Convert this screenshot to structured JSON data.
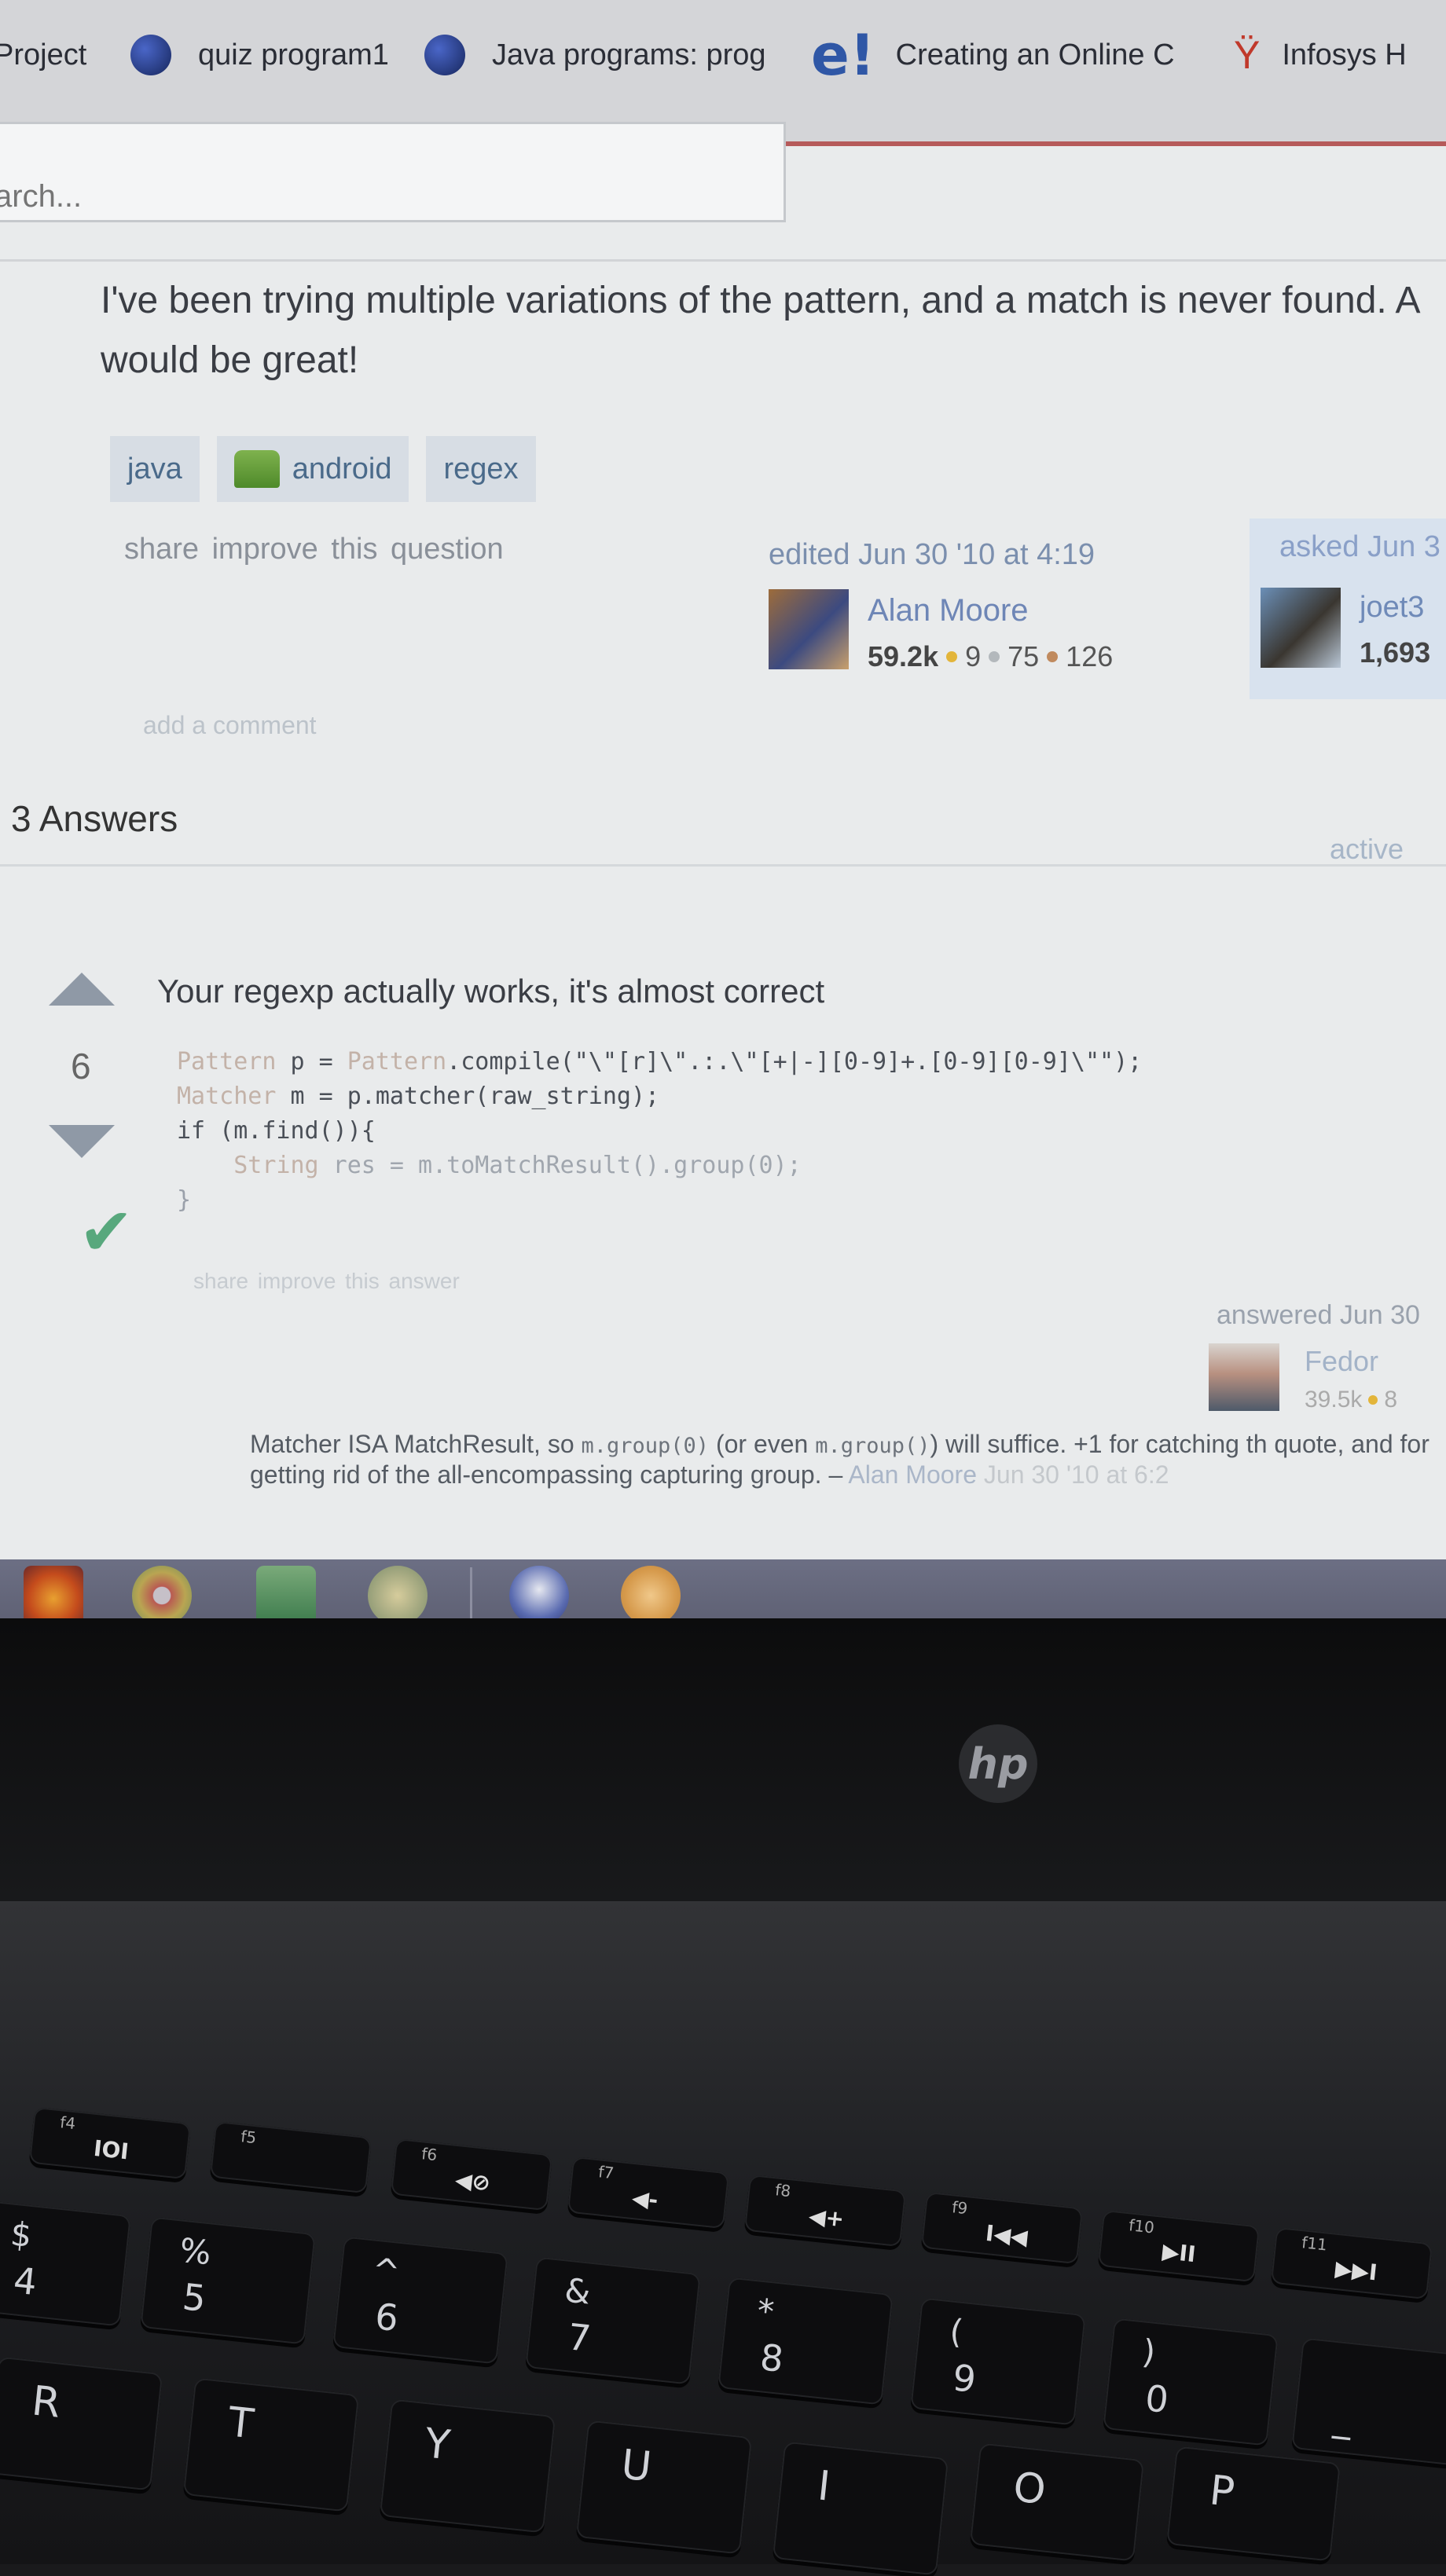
{
  "browser": {
    "bookmarks": [
      {
        "label": "Project",
        "icon": "none"
      },
      {
        "label": "quiz program1",
        "icon": "globe-icon"
      },
      {
        "label": "Java programs: prog",
        "icon": "globe-icon"
      },
      {
        "label": "Creating an Online C",
        "icon": "e-logo-icon"
      },
      {
        "label": "Infosys H",
        "icon": "infosys-icon"
      }
    ],
    "search_placeholder": "arch..."
  },
  "question": {
    "text": "I've been trying multiple variations of the pattern, and a match is never found. A would be great!",
    "tags": [
      "java",
      "android",
      "regex"
    ],
    "links": "share improve this question",
    "edited": {
      "label": "edited Jun 30 '10 at 4:19",
      "user": "Alan Moore",
      "rep": "59.2k",
      "gold": "9",
      "silver": "75",
      "bronze": "126"
    },
    "asked": {
      "label": "asked Jun 3",
      "user": "joet3",
      "rep": "1,693"
    },
    "add_comment": "add a comment"
  },
  "answers": {
    "heading": "3 Answers",
    "sort_tab": "active",
    "items": [
      {
        "votes": "6",
        "accepted": true,
        "intro": "Your regexp actually works, it's almost correct",
        "code": {
          "line1_type": "Pattern",
          "line1_rest": " p = ",
          "line1_call": "Pattern",
          "line1_tail": ".compile(\"\\\"[r]\\\".:.\\\"[+|-][0-9]+.[0-9][0-9]\\\"\");",
          "line2_type": "Matcher",
          "line2_rest": " m = p.matcher(raw_string);",
          "line3": "if (m.find()){",
          "line4_type": "String",
          "line4_rest": " res = m.toMatchResult().group(0);",
          "line5": "}"
        },
        "links": "share improve this answer",
        "answered": {
          "label": "answered Jun 30",
          "user": "Fedor",
          "rep": "39.5k",
          "gold": "8"
        },
        "comment": {
          "part1": "Matcher ISA MatchResult, so ",
          "code1": "m.group(0)",
          "part2": " (or even ",
          "code2": "m.group()",
          "part3": ") will suffice. +1 for catching th quote, and for getting rid of the all-encompassing capturing group. – ",
          "user": "Alan Moore",
          "date": " Jun 30 '10 at 6:2"
        }
      }
    ]
  },
  "taskbar": {
    "apps": [
      "firefox-icon",
      "chrome-icon",
      "store-icon",
      "app-icon",
      "globe-app-icon",
      "settings-app-icon"
    ]
  },
  "laptop": {
    "brand": "hp",
    "function_keys": [
      {
        "num": "f4",
        "sym": "IOI"
      },
      {
        "num": "f5",
        "sym": ""
      },
      {
        "num": "f6",
        "sym": "◀⊘"
      },
      {
        "num": "f7",
        "sym": "◀-"
      },
      {
        "num": "f8",
        "sym": "◀+"
      },
      {
        "num": "f9",
        "sym": "I◀◀"
      },
      {
        "num": "f10",
        "sym": "▶II"
      },
      {
        "num": "f11",
        "sym": "▶▶I"
      }
    ],
    "number_keys": [
      {
        "top": "$",
        "bottom": "4"
      },
      {
        "top": "%",
        "bottom": "5"
      },
      {
        "top": "^",
        "bottom": "6"
      },
      {
        "top": "&",
        "bottom": "7"
      },
      {
        "top": "*",
        "bottom": "8"
      },
      {
        "top": "(",
        "bottom": "9"
      },
      {
        "top": ")",
        "bottom": "0"
      },
      {
        "top": "",
        "bottom": "_"
      }
    ],
    "letter_keys": [
      "R",
      "T",
      "Y",
      "U",
      "I",
      "O",
      "P"
    ]
  },
  "colors": {
    "link": "#6e86b6",
    "accent_bar": "#b65a5a",
    "accepted": "#58a87d",
    "gold": "#e3b53a",
    "silver": "#b3b8bc",
    "bronze": "#c08a5e"
  }
}
